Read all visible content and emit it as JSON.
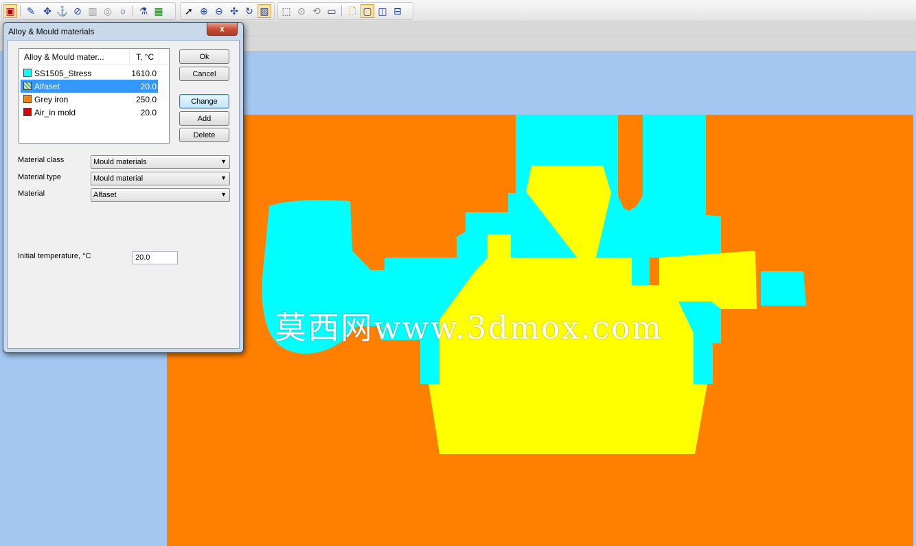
{
  "toolbar": {
    "icons": [
      "dam-icon",
      "pen-icon",
      "move-icon",
      "anchor-icon",
      "circle-slash-icon",
      "grid-icon",
      "sphere-icon",
      "ring-icon",
      "flask-icon",
      "grid-window-icon",
      "cursor-icon",
      "zoom-in-icon",
      "zoom-out-icon",
      "pan-icon",
      "rotate-icon",
      "hatch-icon",
      "select-rect-icon",
      "zoom-window-icon",
      "view-3d-icon",
      "frame-icon",
      "new-doc-icon",
      "single-view-icon",
      "split-vertical-icon",
      "split-horizontal-icon"
    ]
  },
  "dialog": {
    "title": "Alloy & Mould materials",
    "close_label": "x",
    "list": {
      "col_name": "Alloy & Mould mater...",
      "col_temp": "T, °C",
      "rows": [
        {
          "name": "SS1505_Stress",
          "temp": "1610.0",
          "color": "#00ffff"
        },
        {
          "name": "Alfaset",
          "temp": "20.0",
          "color": "#7fbf7f",
          "selected": true
        },
        {
          "name": "Grey iron",
          "temp": "250.0",
          "color": "#ff8000"
        },
        {
          "name": "Air_in mold",
          "temp": "20.0",
          "color": "#e00000"
        }
      ]
    },
    "buttons": {
      "ok": "Ok",
      "cancel": "Cancel",
      "change": "Change",
      "add": "Add",
      "delete": "Delete"
    },
    "fields": {
      "material_class_label": "Material class",
      "material_class_value": "Mould materials",
      "material_type_label": "Material type",
      "material_type_value": "Mould material",
      "material_label": "Material",
      "material_value": "Alfaset",
      "initial_temp_label": "Initial temperature, °C",
      "initial_temp_value": "20.0"
    }
  },
  "canvas": {
    "watermark": "莫西网www.3dmox.com",
    "colors": {
      "background": "#a3c7f0",
      "mould": "#ff8000",
      "alloy": "#00ffff",
      "core": "#ffff00"
    }
  }
}
